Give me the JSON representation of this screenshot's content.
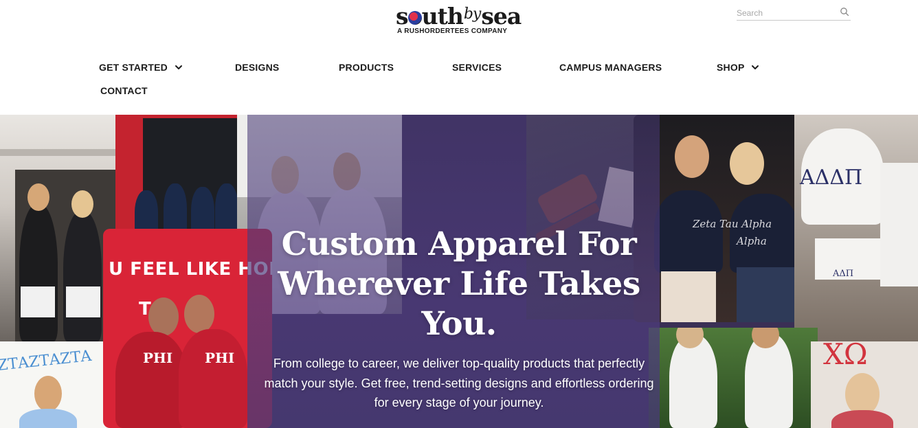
{
  "brand": {
    "name_part1": "s",
    "name_part2": "uth",
    "name_by": "by",
    "name_part3": "sea",
    "tagline": "A RUSHORDERTEES COMPANY"
  },
  "search": {
    "placeholder": "Search",
    "value": ""
  },
  "nav": {
    "get_started": "GET STARTED",
    "designs": "DESIGNS",
    "products": "PRODUCTS",
    "services": "SERVICES",
    "campus_managers": "CAMPUS MANAGERS",
    "shop": "SHOP",
    "contact": "CONTACT"
  },
  "hero": {
    "headline_line1": "Custom Apparel For",
    "headline_line2": "Wherever Life Takes",
    "headline_line3": "You.",
    "subtext_line1": "From college to career, we deliver top-quality products that perfectly",
    "subtext_line2": "match your style. Get free, trend-setting designs and effortless ordering",
    "subtext_line3": "for every stage of your journey.",
    "photo_texts": {
      "sign": "U FEEL LIKE HOM",
      "sign2": "TO",
      "shirt_left": "PHI",
      "shirt_right": "PHI",
      "tank_text": "Zeta Tau Alpha",
      "tank_text2": "Alpha",
      "adp_top": "ΑΔΔΠ",
      "adp_shorts": "ΑΔΠ",
      "zta_banner": "ΖΤΑΖΤΑΖΤΑ",
      "xo": "ΧΩ"
    }
  },
  "colors": {
    "overlay": "#4e3c7d",
    "red_sign": "#d92437",
    "text_dark": "#1c1c1c"
  },
  "icons": {
    "search": "search-icon",
    "chevron": "chevron-down-icon"
  }
}
